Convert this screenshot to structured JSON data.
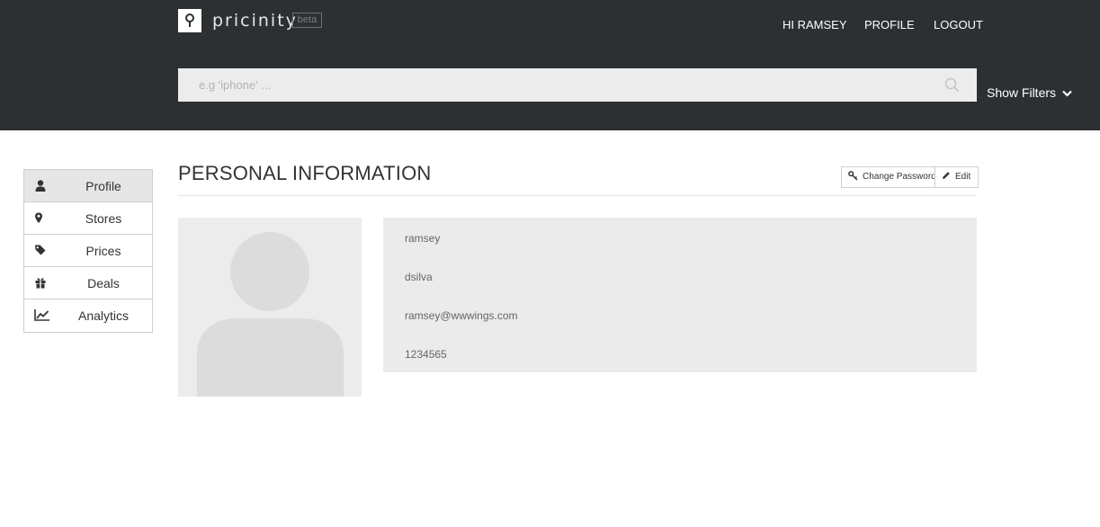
{
  "header": {
    "brand": "pricinity",
    "beta_badge": "beta",
    "nav": {
      "greeting": "HI RAMSEY",
      "profile": "PROFILE",
      "logout": "LOGOUT"
    },
    "search": {
      "placeholder": "e.g 'iphone' ...",
      "value": ""
    },
    "show_filters": "Show Filters"
  },
  "sidebar": {
    "items": [
      {
        "label": "Profile",
        "icon": "user-icon",
        "active": true
      },
      {
        "label": "Stores",
        "icon": "map-marker-icon",
        "active": false
      },
      {
        "label": "Prices",
        "icon": "tag-icon",
        "active": false
      },
      {
        "label": "Deals",
        "icon": "gift-icon",
        "active": false
      },
      {
        "label": "Analytics",
        "icon": "line-chart-icon",
        "active": false
      }
    ]
  },
  "main": {
    "title": "PERSONAL INFORMATION",
    "actions": {
      "change_password": "Change Password",
      "edit": "Edit"
    },
    "profile": {
      "first_name": "ramsey",
      "last_name": "dsilva",
      "email": "ramsey@wwwings.com",
      "phone": "1234565"
    }
  },
  "colors": {
    "header_bg": "#2d3033",
    "panel_bg": "#ebebec",
    "active_item_bg": "#e6e6e6"
  }
}
